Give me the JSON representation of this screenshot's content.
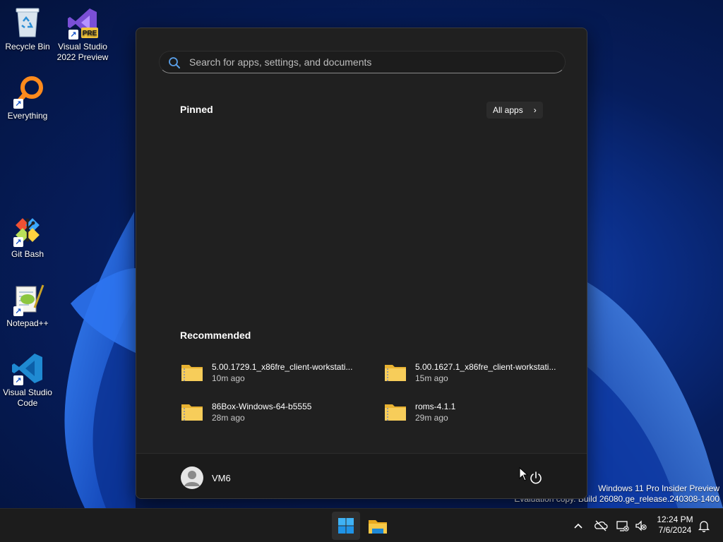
{
  "desktop": {
    "icons": [
      {
        "label": "Recycle Bin"
      },
      {
        "label": "Visual Studio 2022 Preview",
        "badge": "PRE"
      },
      {
        "label": "Everything"
      },
      {
        "label": "Git Bash"
      },
      {
        "label": "Notepad++"
      },
      {
        "label": "Visual Studio Code"
      }
    ],
    "watermark": {
      "line1": "Windows 11 Pro Insider Preview",
      "line2": "Evaluation copy. Build 26080.ge_release.240308-1400"
    }
  },
  "start_menu": {
    "search": {
      "placeholder": "Search for apps, settings, and documents",
      "value": ""
    },
    "pinned": {
      "title": "Pinned",
      "all_apps_label": "All apps",
      "all_apps_icon": "chevron-right-icon"
    },
    "recommended": {
      "title": "Recommended",
      "items": [
        {
          "name": "5.00.1729.1_x86fre_client-workstati...",
          "time": "10m ago",
          "icon": "zip-folder-icon"
        },
        {
          "name": "5.00.1627.1_x86fre_client-workstati...",
          "time": "15m ago",
          "icon": "zip-folder-icon"
        },
        {
          "name": "86Box-Windows-64-b5555",
          "time": "28m ago",
          "icon": "zip-folder-icon"
        },
        {
          "name": "roms-4.1.1",
          "time": "29m ago",
          "icon": "zip-folder-icon"
        }
      ]
    },
    "user": {
      "name": "VM6",
      "icon": "user-avatar-icon"
    },
    "power_icon": "power-icon"
  },
  "taskbar": {
    "apps": [
      "start-icon",
      "file-explorer-icon"
    ],
    "tray": [
      "chevron-up-icon",
      "onedrive-offline-icon",
      "network-icon",
      "volume-muted-icon"
    ],
    "clock": {
      "time": "12:24 PM",
      "date": "7/6/2024"
    },
    "notification_icon": "bell-icon"
  },
  "colors": {
    "menu_bg": "#202020",
    "accent": "#0078d4",
    "folder": "#f5c542"
  }
}
